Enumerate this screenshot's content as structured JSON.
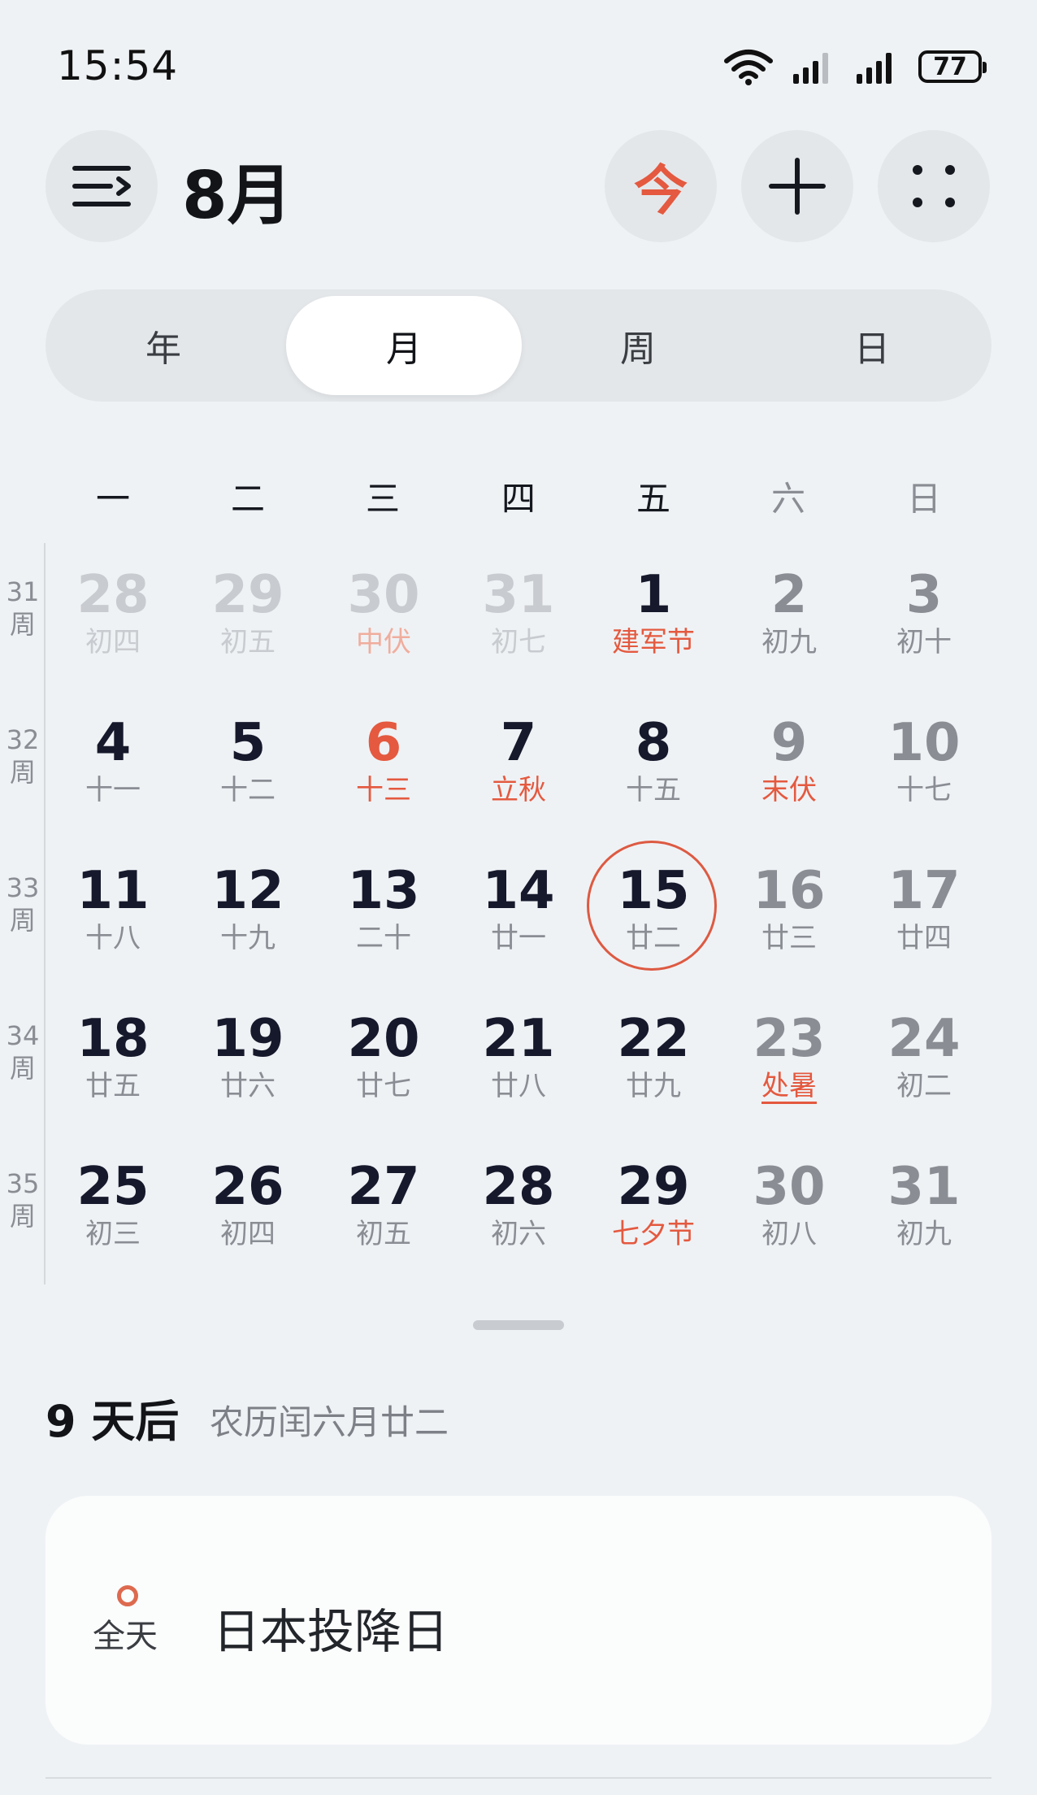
{
  "status": {
    "time": "15:54",
    "battery": "77"
  },
  "header": {
    "month": "8月",
    "today_label": "今"
  },
  "tabs": [
    "年",
    "月",
    "周",
    "日"
  ],
  "active_tab": "月",
  "weekdays": [
    "一",
    "二",
    "三",
    "四",
    "五",
    "六",
    "日"
  ],
  "weeks": [
    {
      "num": "31",
      "unit": "周",
      "days": [
        {
          "d": "28",
          "l": "初四",
          "other": true
        },
        {
          "d": "29",
          "l": "初五",
          "other": true
        },
        {
          "d": "30",
          "l": "中伏",
          "other": true,
          "red": true
        },
        {
          "d": "31",
          "l": "初七",
          "other": true
        },
        {
          "d": "1",
          "l": "建军节",
          "red": true
        },
        {
          "d": "2",
          "l": "初九"
        },
        {
          "d": "3",
          "l": "初十"
        }
      ]
    },
    {
      "num": "32",
      "unit": "周",
      "days": [
        {
          "d": "4",
          "l": "十一"
        },
        {
          "d": "5",
          "l": "十二"
        },
        {
          "d": "6",
          "l": "十三",
          "red": true,
          "numred": true
        },
        {
          "d": "7",
          "l": "立秋",
          "red": true
        },
        {
          "d": "8",
          "l": "十五"
        },
        {
          "d": "9",
          "l": "末伏",
          "red": true
        },
        {
          "d": "10",
          "l": "十七"
        }
      ]
    },
    {
      "num": "33",
      "unit": "周",
      "days": [
        {
          "d": "11",
          "l": "十八"
        },
        {
          "d": "12",
          "l": "十九"
        },
        {
          "d": "13",
          "l": "二十"
        },
        {
          "d": "14",
          "l": "廿一"
        },
        {
          "d": "15",
          "l": "廿二",
          "today": true
        },
        {
          "d": "16",
          "l": "廿三"
        },
        {
          "d": "17",
          "l": "廿四"
        }
      ]
    },
    {
      "num": "34",
      "unit": "周",
      "days": [
        {
          "d": "18",
          "l": "廿五"
        },
        {
          "d": "19",
          "l": "廿六"
        },
        {
          "d": "20",
          "l": "廿七"
        },
        {
          "d": "21",
          "l": "廿八"
        },
        {
          "d": "22",
          "l": "廿九"
        },
        {
          "d": "23",
          "l": "处暑",
          "red": true,
          "uline": true
        },
        {
          "d": "24",
          "l": "初二"
        }
      ]
    },
    {
      "num": "35",
      "unit": "周",
      "days": [
        {
          "d": "25",
          "l": "初三"
        },
        {
          "d": "26",
          "l": "初四"
        },
        {
          "d": "27",
          "l": "初五"
        },
        {
          "d": "28",
          "l": "初六"
        },
        {
          "d": "29",
          "l": "七夕节",
          "red": true
        },
        {
          "d": "30",
          "l": "初八"
        },
        {
          "d": "31",
          "l": "初九"
        }
      ]
    }
  ],
  "selected": {
    "countdown": "9 天后",
    "lunar_date": "农历闰六月廿二"
  },
  "event": {
    "allday_label": "全天",
    "title": "日本投降日"
  },
  "colors": {
    "accent": "#e4593f",
    "background": "#eff2f5"
  },
  "icons": {
    "menu": "menu-icon",
    "add": "plus-icon",
    "more": "grid-dots-icon",
    "today": "today-icon"
  }
}
